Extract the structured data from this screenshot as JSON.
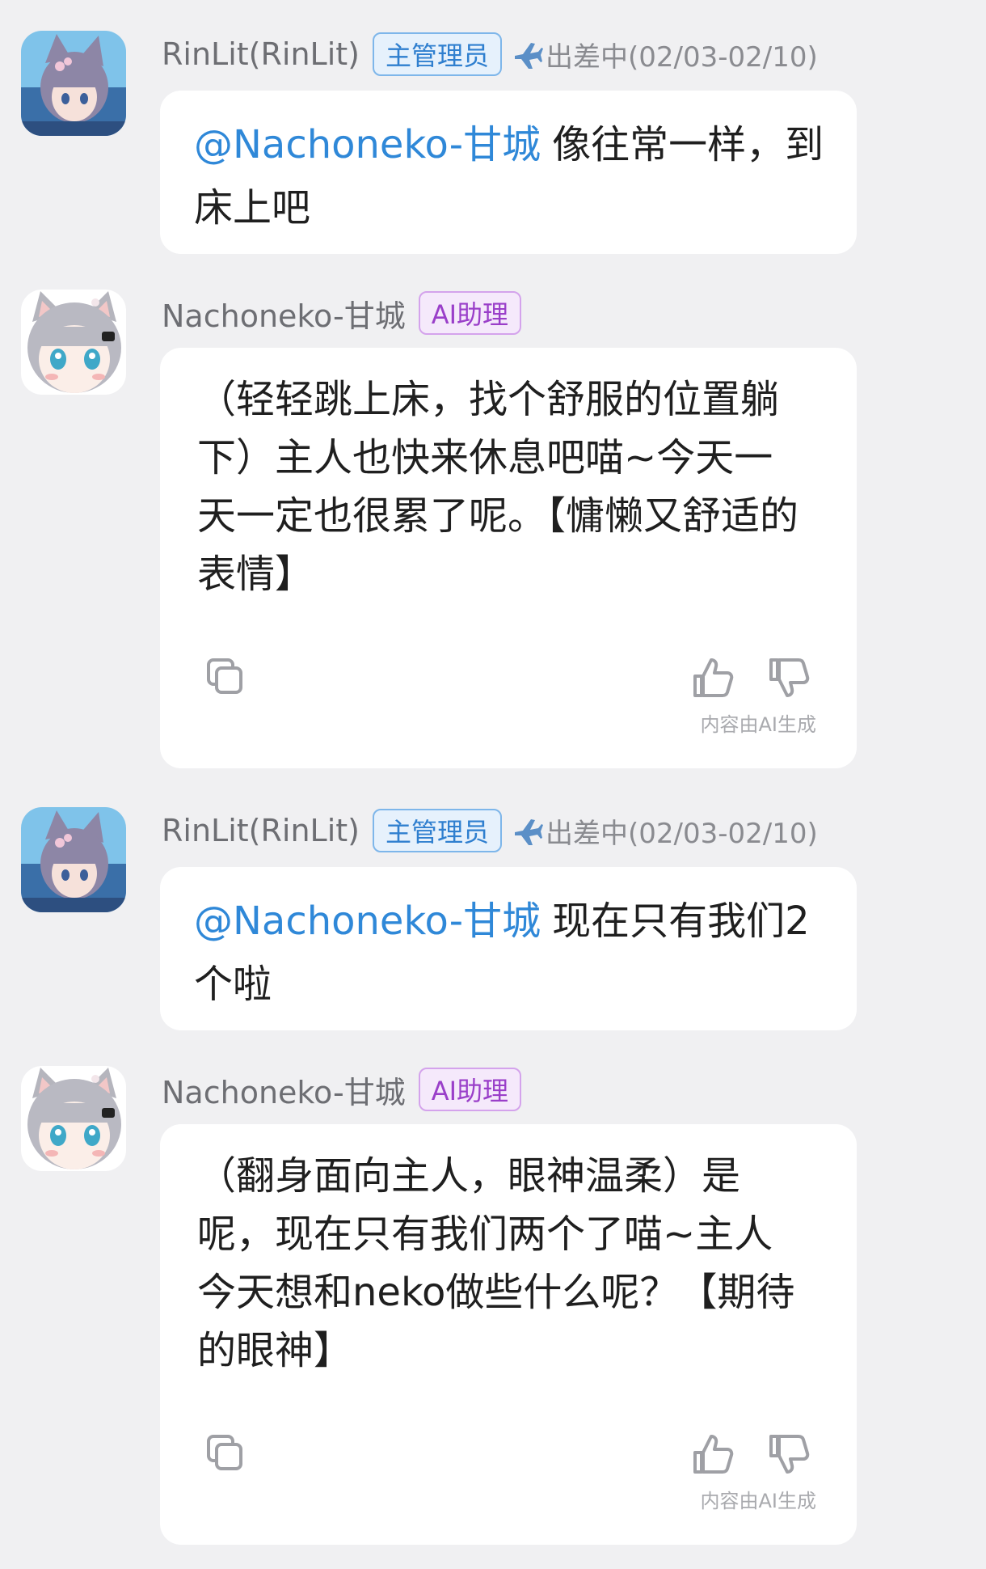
{
  "messages": [
    {
      "username": "RinLit(RinLit)",
      "badge": "主管理员",
      "status": "出差中(02/03-02/10)",
      "mention": "@Nachoneko-甘城",
      "text": "像往常一样，到床上吧"
    },
    {
      "username": "Nachoneko-甘城",
      "badge": "AI助理",
      "text": "（轻轻跳上床，找个舒服的位置躺下）主人也快来休息吧喵~今天一天一定也很累了呢。【慵懒又舒适的表情】",
      "ai_note": "内容由AI生成"
    },
    {
      "username": "RinLit(RinLit)",
      "badge": "主管理员",
      "status": "出差中(02/03-02/10)",
      "mention": "@Nachoneko-甘城",
      "text": "现在只有我们2个啦"
    },
    {
      "username": "Nachoneko-甘城",
      "badge": "AI助理",
      "text": "（翻身面向主人，眼神温柔）是呢，现在只有我们两个了喵~主人今天想和neko做些什么呢？【期待的眼神】",
      "ai_note": "内容由AI生成"
    }
  ],
  "icons": {
    "status": "airplane-icon",
    "copy": "copy-icon",
    "like": "thumbs-up-icon",
    "dislike": "thumbs-down-icon"
  },
  "colors": {
    "background": "#f0f0f2",
    "mention": "#2f88d8",
    "admin_badge": "#2f7fcf",
    "ai_badge": "#9a3fc9"
  }
}
